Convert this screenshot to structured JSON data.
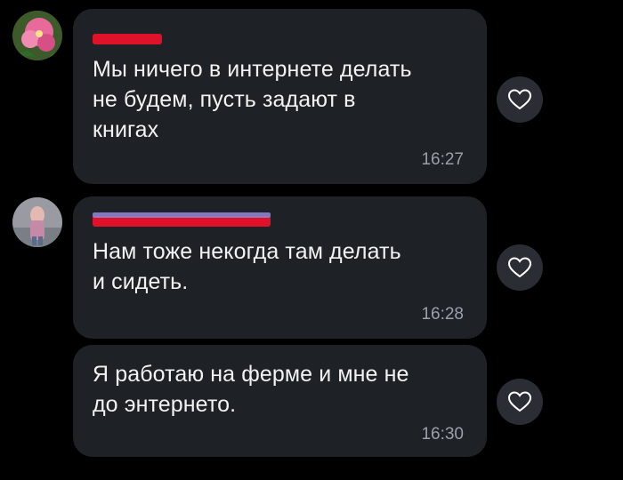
{
  "messages": [
    {
      "text_line1": "Мы ничего в интернете делать",
      "text_line2": "не будем, пусть задают в",
      "text_line3": "книгах",
      "time": "16:27"
    },
    {
      "text_line1": "Нам тоже некогда там делать",
      "text_line2": "и сидеть.",
      "time": "16:28"
    },
    {
      "text_line1": "Я работаю на ферме и мне не",
      "text_line2": "до энтернето.",
      "time": "16:30"
    }
  ],
  "colors": {
    "background": "#000000",
    "bubble": "#1e2126",
    "text": "#f2f2f2",
    "time": "#9aa0a8",
    "redaction": "#e0122a"
  },
  "icons": {
    "like": "heart-outline-icon"
  }
}
